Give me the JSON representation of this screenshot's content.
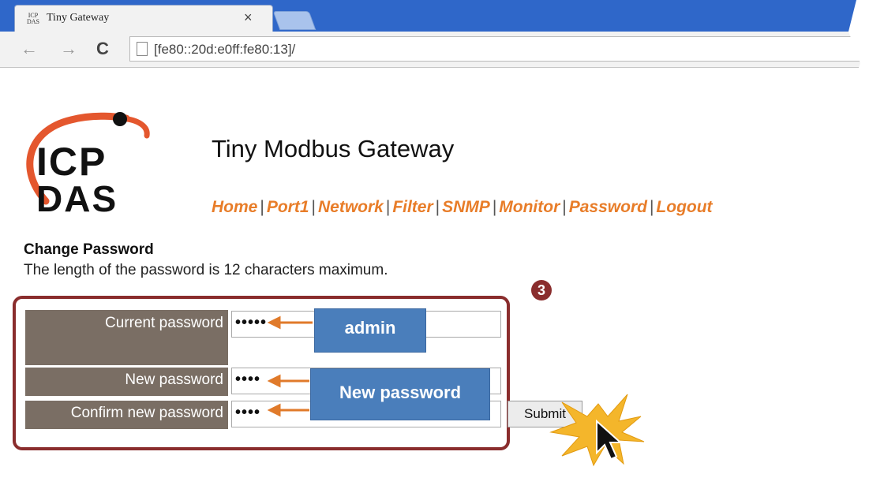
{
  "browser": {
    "tab_title": "Tiny Gateway",
    "tab_close": "×",
    "favicon_text": "ICP DAS",
    "address": "[fe80::20d:e0ff:fe80:13]/",
    "back": "←",
    "forward": "→",
    "reload": "C"
  },
  "page": {
    "logo_top": "ICP",
    "logo_bottom": "DAS",
    "title": "Tiny Modbus Gateway",
    "nav": [
      "Home",
      "Port1",
      "Network",
      "Filter",
      "SNMP",
      "Monitor",
      "Password",
      "Logout"
    ],
    "nav_separator": "|"
  },
  "form": {
    "heading": "Change Password",
    "description": "The length of the password is 12 characters maximum.",
    "current_label": "Current password",
    "current_value": "•••••",
    "new_label": "New password",
    "new_value": "••••",
    "confirm_label": "Confirm new password",
    "confirm_value": "••••",
    "submit_label": "Submit"
  },
  "annotations": {
    "step_badge": "3",
    "callout_admin": "admin",
    "callout_new": "New password",
    "frame_color": "#8a2d2d",
    "callout_color": "#4a7ebb",
    "arrow_color": "#e07a2a"
  },
  "colors": {
    "browser_blue": "#2f67c9",
    "nav_orange": "#e87d29",
    "label_bg": "#7a6e64"
  }
}
